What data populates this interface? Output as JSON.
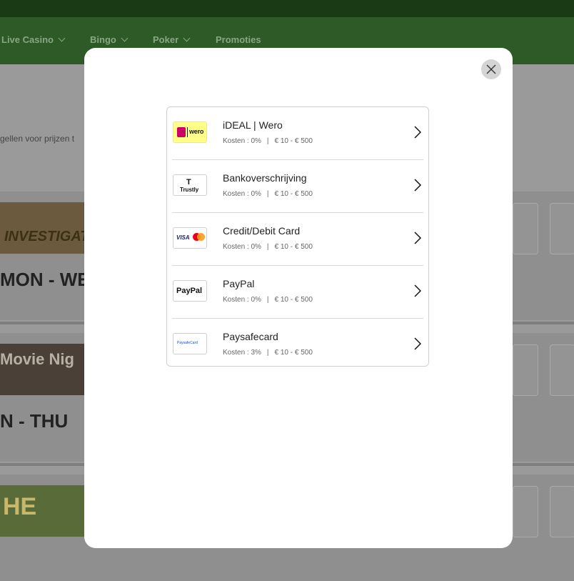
{
  "background": {
    "nav": [
      {
        "label": "Live Casino",
        "dropdown": true
      },
      {
        "label": "Bingo",
        "dropdown": true
      },
      {
        "label": "Poker",
        "dropdown": true
      },
      {
        "label": "Promoties",
        "dropdown": false
      }
    ],
    "subtext": "gellen voor prijzen t",
    "promos": [
      {
        "banner_text": "INVESTIGAT",
        "day": "MON - WED"
      },
      {
        "banner_text": "Movie Nig",
        "day": "N - THU"
      },
      {
        "banner_text": "HE",
        "day": ""
      }
    ]
  },
  "modal": {
    "close_icon": "close-icon",
    "methods": [
      {
        "name": "iDEAL | Wero",
        "fee": "Kosten : 0%",
        "range": "€ 10 - € 500",
        "logo": "ideal-wero-logo",
        "logo_text": "wero"
      },
      {
        "name": "Bankoverschrijving",
        "fee": "Kosten : 0%",
        "range": "€ 10 - € 500",
        "logo": "trustly-logo",
        "logo_text": "Trustly"
      },
      {
        "name": "Credit/Debit Card",
        "fee": "Kosten : 0%",
        "range": "€ 10 - € 500",
        "logo": "visa-mastercard-logo",
        "logo_text": "VISA"
      },
      {
        "name": "PayPal",
        "fee": "Kosten : 0%",
        "range": "€ 10 - € 500",
        "logo": "paypal-logo",
        "logo_text": "PayPal"
      },
      {
        "name": "Paysafecard",
        "fee": "Kosten : 3%",
        "range": "€ 10 - € 500",
        "logo": "paysafecard-logo",
        "logo_text": "PaysafeCard"
      }
    ],
    "separator": "|"
  },
  "colors": {
    "overlay": "#9a9a9a",
    "nav_green": "#2e5a27",
    "modal_bg": "#ffffff"
  }
}
